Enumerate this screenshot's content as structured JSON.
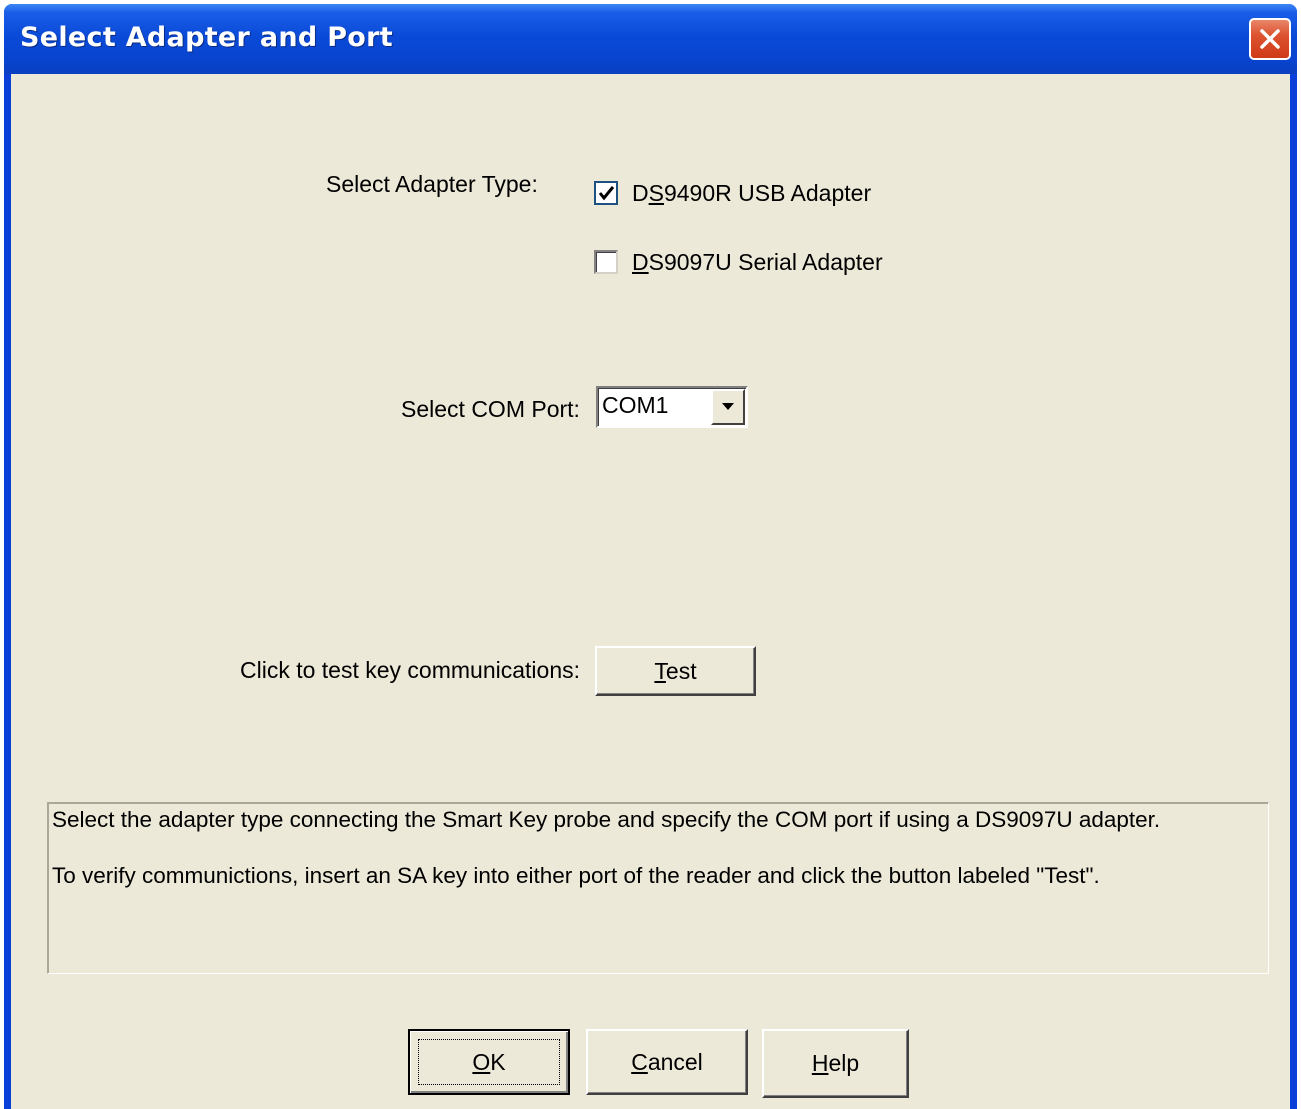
{
  "window": {
    "title": "Select Adapter and Port"
  },
  "adapter": {
    "label": "Select Adapter Type:",
    "options": [
      {
        "pre": "D",
        "accel": "S",
        "post": "9490R USB Adapter",
        "checked": true
      },
      {
        "pre": "",
        "accel": "D",
        "post": "S9097U Serial Adapter",
        "checked": false
      }
    ]
  },
  "com": {
    "label": "Select COM Port:",
    "value": "COM1"
  },
  "test": {
    "label": "Click to test key communications:",
    "button_accel": "T",
    "button_rest": "est"
  },
  "info": {
    "line1": "Select the adapter type connecting the Smart Key probe and specify the COM port if using a DS9097U adapter.",
    "line2": "To verify communictions, insert an SA key into either port of the reader and click the button labeled \"Test\"."
  },
  "buttons": {
    "ok_accel": "O",
    "ok_rest": "K",
    "cancel_accel": "C",
    "cancel_rest": "ancel",
    "help_accel": "H",
    "help_rest": "elp"
  }
}
